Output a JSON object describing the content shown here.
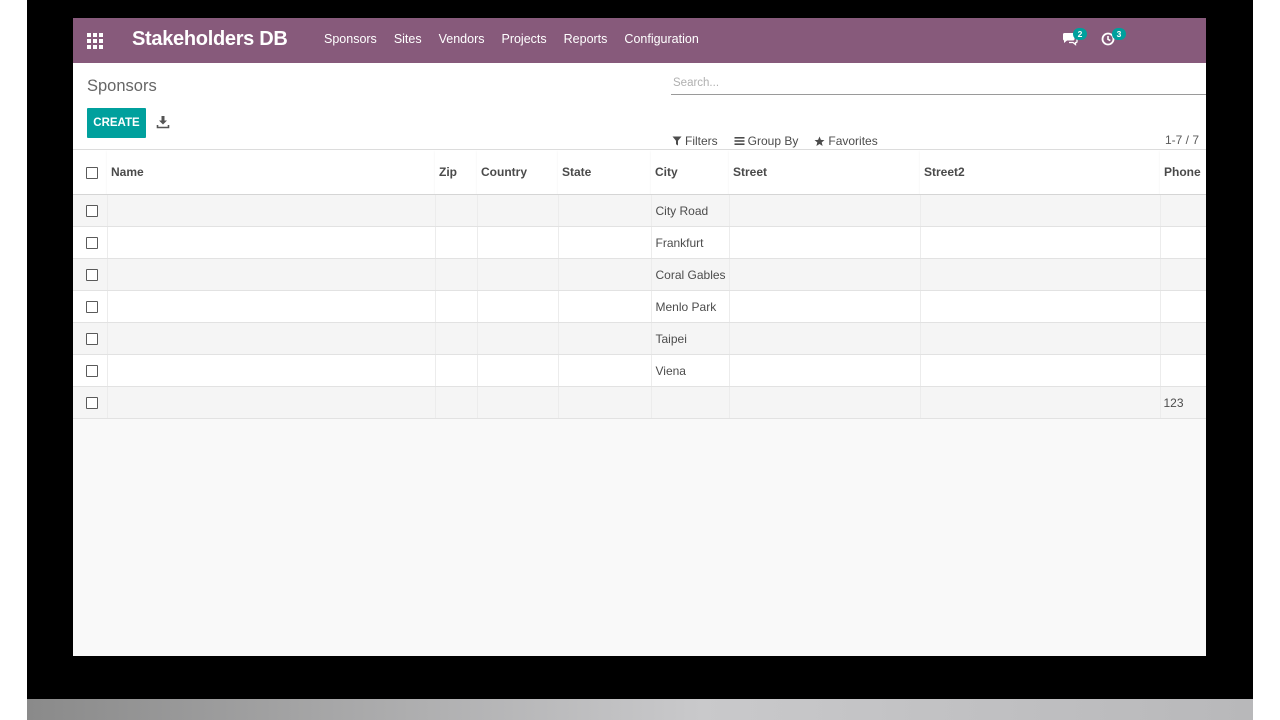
{
  "navbar": {
    "brand": "Stakeholders DB",
    "menu": [
      "Sponsors",
      "Sites",
      "Vendors",
      "Projects",
      "Reports",
      "Configuration"
    ],
    "messages_count": "2",
    "activities_count": "3",
    "color": "#875a7b"
  },
  "control_panel": {
    "breadcrumb": "Sponsors",
    "search_placeholder": "Search...",
    "create_label": "CREATE",
    "filters_label": "Filters",
    "group_by_label": "Group By",
    "favorites_label": "Favorites",
    "pager": "1-7 / 7",
    "accent_color": "#00a09d"
  },
  "table": {
    "columns": [
      "Name",
      "Zip",
      "Country",
      "State",
      "City",
      "Street",
      "Street2",
      "Phone"
    ],
    "rows": [
      [
        "",
        "",
        "",
        "",
        "City Road",
        "",
        "",
        ""
      ],
      [
        "",
        "",
        "",
        "",
        "Frankfurt",
        "",
        "",
        ""
      ],
      [
        "",
        "",
        "",
        "",
        "Coral Gables",
        "",
        "",
        ""
      ],
      [
        "",
        "",
        "",
        "",
        "Menlo Park",
        "",
        "",
        ""
      ],
      [
        "",
        "",
        "",
        "",
        "Taipei",
        "",
        "",
        ""
      ],
      [
        "",
        "",
        "",
        "",
        "Viena",
        "",
        "",
        ""
      ],
      [
        "",
        "",
        "",
        "",
        "",
        "",
        "",
        "123"
      ]
    ]
  },
  "icons": {
    "apps": "apps-grid-icon",
    "messages": "chat-icon",
    "activities": "clock-icon",
    "download": "download-icon",
    "filters": "funnel-icon",
    "group_by": "list-icon",
    "favorites": "star-icon"
  }
}
